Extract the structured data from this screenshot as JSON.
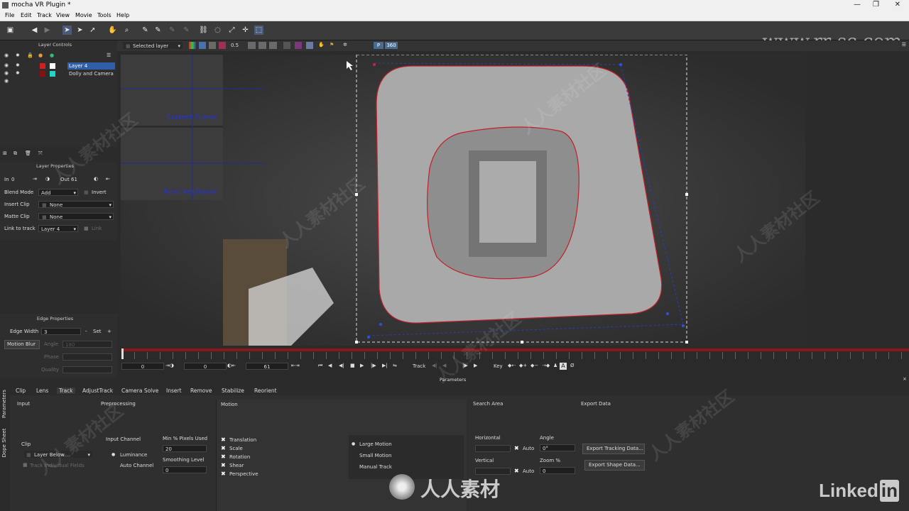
{
  "window": {
    "title": "mocha VR Plugin *",
    "minimize": "—",
    "restore": "❐",
    "close": "✕"
  },
  "watermark": {
    "url": "www.rr-sc.com",
    "cn": "人人素材社区",
    "logo_text": "人人素材",
    "linkedin": "Linked",
    "linkedin_in": "in"
  },
  "menu": [
    "File",
    "Edit",
    "Track",
    "View",
    "Movie",
    "Tools",
    "Help"
  ],
  "viewer_toolbar": {
    "layer_select": "Selected layer",
    "opacity": "0.5",
    "p_button": "P",
    "vr_button": "360"
  },
  "layer_controls": {
    "title": "Layer Controls",
    "layers": [
      {
        "name": "Layer 4",
        "color": "#d81b1b",
        "selected": true
      },
      {
        "name": "Dolly and Camera",
        "color": "#22d3c8",
        "selected": false
      }
    ]
  },
  "layer_properties": {
    "title": "Layer Properties",
    "in_label": "In",
    "in_value": "0",
    "out_label": "Out",
    "out_value": "61",
    "blend_mode_label": "Blend Mode",
    "blend_mode_value": "Add",
    "invert_label": "Invert",
    "insert_clip_label": "Insert Clip",
    "insert_clip_value": "None",
    "matte_clip_label": "Matte Clip",
    "matte_clip_value": "None",
    "link_to_track_label": "Link to track",
    "link_to_track_value": "Layer 4",
    "link_extra": "Link"
  },
  "edge_properties": {
    "title": "Edge Properties",
    "edge_width_label": "Edge Width",
    "edge_width_value": "3",
    "minus": "-",
    "set": "Set",
    "plus": "+",
    "motion_blur_label": "Motion Blur",
    "angle_label": "Angle",
    "angle_value": "180",
    "phase_label": "Phase",
    "quality_label": "Quality"
  },
  "viewer": {
    "current_frame_label": "Current Frame",
    "next_keyframe_label": "Next Keyframe"
  },
  "timeline": {
    "start": "0",
    "in": "0",
    "out": "61",
    "track_label": "Track",
    "key_label": "Key"
  },
  "parameters_label": "Parameters",
  "side_tabs": [
    "Parameters",
    "Dope Sheet"
  ],
  "tabs": [
    "Clip",
    "Lens",
    "Track",
    "AdjustTrack",
    "Camera Solve",
    "Insert",
    "Remove",
    "Stabilize",
    "Reorient"
  ],
  "active_tab": "Track",
  "params": {
    "input": {
      "title": "Input",
      "clip_label": "Clip",
      "clip_value": "Layer Below",
      "track_individual": "Track Individual Fields"
    },
    "preprocessing": {
      "title": "Preprocessing",
      "input_channel_label": "Input Channel",
      "luminance": "Luminance",
      "auto_channel": "Auto Channel",
      "min_pixels_label": "Min % Pixels Used",
      "min_pixels_value": "20",
      "smoothing_label": "Smoothing Level",
      "smoothing_value": "0"
    },
    "motion": {
      "title": "Motion",
      "checks": [
        "Translation",
        "Scale",
        "Rotation",
        "Shear",
        "Perspective"
      ],
      "radios": [
        "Large Motion",
        "Small Motion",
        "Manual Track"
      ],
      "selected_radio": "Large Motion"
    },
    "search_area": {
      "title": "Search Area",
      "horizontal_label": "Horizontal",
      "vertical_label": "Vertical",
      "auto": "Auto",
      "angle_label": "Angle",
      "angle_value": "0°",
      "zoom_label": "Zoom %",
      "zoom_value": "0"
    },
    "export": {
      "title": "Export Data",
      "tracking_btn": "Export Tracking Data...",
      "shape_btn": "Export Shape Data..."
    }
  }
}
